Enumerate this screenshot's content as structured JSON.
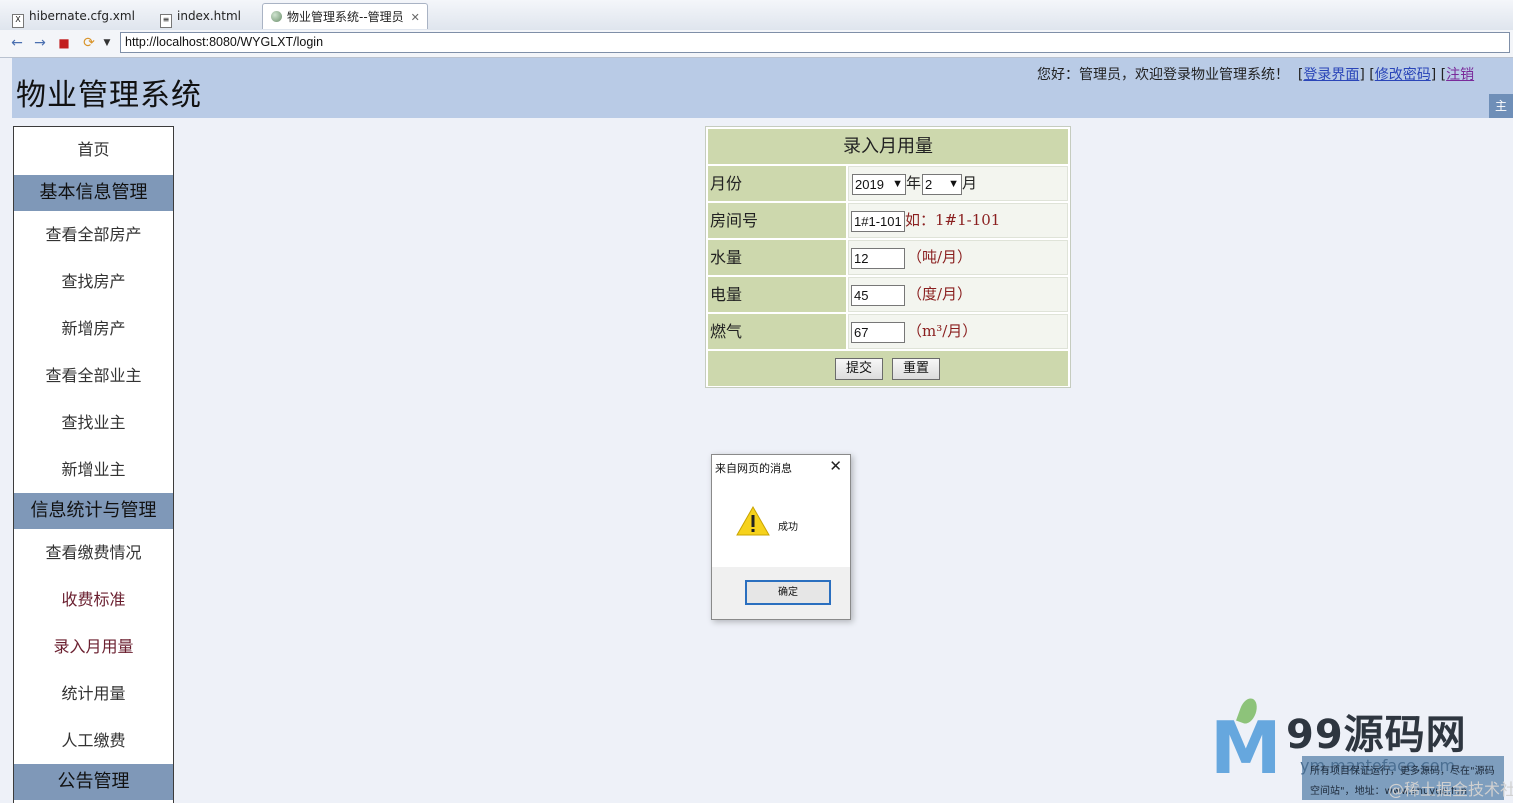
{
  "browser": {
    "tabs": [
      {
        "label": "hibernate.cfg.xml",
        "icon": "xml-file-icon"
      },
      {
        "label": "index.html",
        "icon": "html-file-icon"
      },
      {
        "label": "物业管理系统--管理员",
        "icon": "globe-icon",
        "active": true
      }
    ],
    "url": "http://localhost:8080/WYGLXT/login",
    "icons": {
      "back": "←",
      "forward": "→",
      "stop": "■",
      "refresh": "⟳",
      "drop": "▼",
      "close": "✕"
    }
  },
  "header": {
    "title": "物业管理系统",
    "welcome": "您好：管理员，欢迎登录物业管理系统！",
    "links": [
      "登录界面",
      "修改密码",
      "注销"
    ],
    "right_button": "主"
  },
  "sidebar": {
    "home": "首页",
    "sections": [
      {
        "title": "基本信息管理",
        "items": [
          "查看全部房产",
          "查找房产",
          "新增房产",
          "查看全部业主",
          "查找业主",
          "新增业主"
        ]
      },
      {
        "title": "信息统计与管理",
        "items": [
          "查看缴费情况",
          "收费标准",
          "录入月用量",
          "统计用量",
          "人工缴费"
        ]
      },
      {
        "title": "公告管理",
        "items": []
      }
    ]
  },
  "form": {
    "title": "录入月用量",
    "month_label": "月份",
    "year_value": "2019",
    "year_suffix": "年",
    "month_value": "2",
    "month_suffix": "月",
    "room_label": "房间号",
    "room_value": "1#1-101",
    "room_hint": "如：1#1-101",
    "water_label": "水量",
    "water_value": "12",
    "water_unit": "（吨/月）",
    "electric_label": "电量",
    "electric_value": "45",
    "electric_unit": "（度/月）",
    "gas_label": "燃气",
    "gas_value": "67",
    "gas_unit": "（m³/月）",
    "submit": "提交",
    "reset": "重置"
  },
  "dialog": {
    "title": "来自网页的消息",
    "message": "成功",
    "ok": "确定"
  },
  "watermark": {
    "brand": "99源码网",
    "domain": "ym.mantoface.com",
    "line1": "所有项目保证运行，更多源码，尽在\"源码",
    "line2": "空间站\"，地址：www.shuyue.fun",
    "community": "@稀土掘金技术社区"
  }
}
